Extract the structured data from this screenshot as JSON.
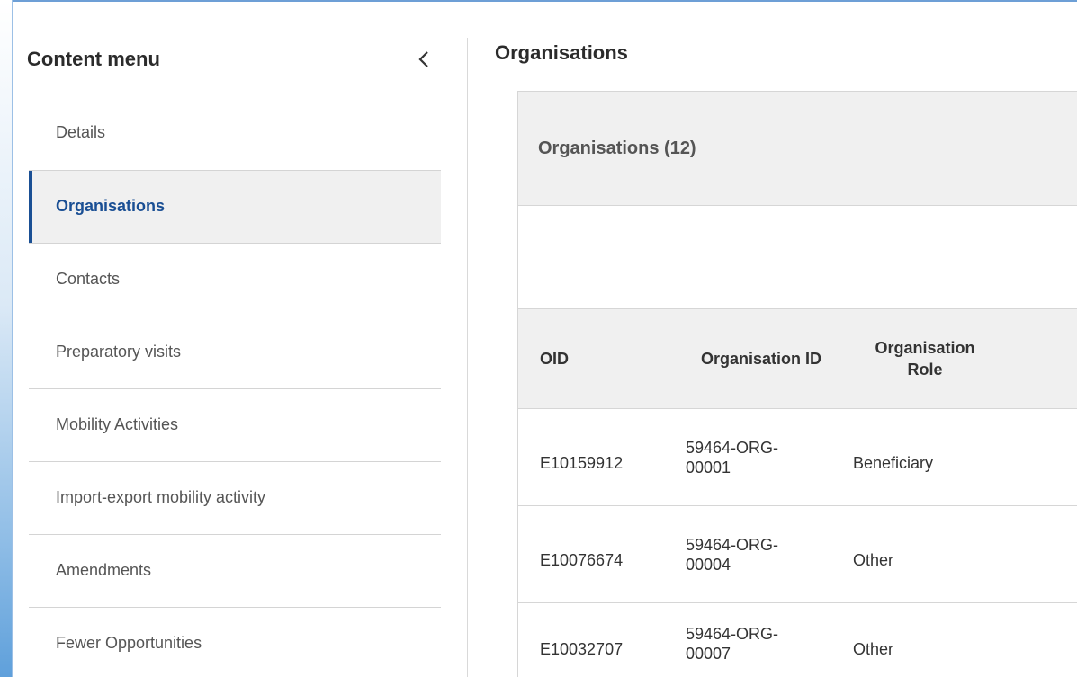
{
  "sidebar": {
    "title": "Content menu",
    "collapse_icon": "chevron-left-icon",
    "items": [
      {
        "label": "Details",
        "active": false
      },
      {
        "label": "Organisations",
        "active": true
      },
      {
        "label": "Contacts",
        "active": false
      },
      {
        "label": "Preparatory visits",
        "active": false
      },
      {
        "label": "Mobility Activities",
        "active": false
      },
      {
        "label": "Import-export mobility activity",
        "active": false
      },
      {
        "label": "Amendments",
        "active": false
      },
      {
        "label": "Fewer Opportunities",
        "active": false
      }
    ]
  },
  "main": {
    "title": "Organisations",
    "card": {
      "title": "Organisations (12)",
      "table": {
        "headers": [
          "OID",
          "Organisation ID",
          "Organisation Role"
        ],
        "rows": [
          {
            "oid": "E10159912",
            "org_id": "59464-ORG-00001",
            "role": "Beneficiary"
          },
          {
            "oid": "E10076674",
            "org_id": "59464-ORG-00004",
            "role": "Other"
          },
          {
            "oid": "E10032707",
            "org_id": "59464-ORG-00007",
            "role": "Other"
          }
        ]
      }
    }
  },
  "colors": {
    "accent": "#1a4f94",
    "active_bg": "#f0f0f0",
    "header_bg": "#f0f0f0",
    "text_muted": "#555555"
  }
}
